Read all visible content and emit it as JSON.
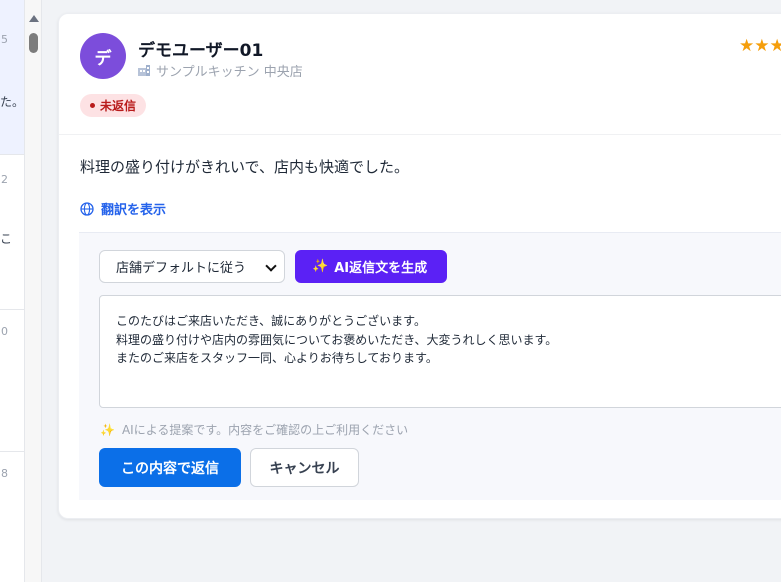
{
  "left_list": {
    "items": [
      {
        "number": "5",
        "fragment": "た。"
      },
      {
        "number": "2",
        "fragment": "こ"
      },
      {
        "number": "0",
        "fragment": ""
      },
      {
        "number": "8",
        "fragment": ""
      }
    ]
  },
  "review": {
    "avatar_initial": "デ",
    "user_name": "デモユーザー01",
    "store_name": "サンプルキッチン 中央店",
    "stars": "★★★",
    "status": "未返信",
    "text": "料理の盛り付けがきれいで、店内も快適でした。",
    "translate_label": "翻訳を表示"
  },
  "reply": {
    "tone_selected": "店舗デフォルトに従う",
    "ai_button_label": "AI返信文を生成",
    "draft": "このたびはご来店いただき、誠にありがとうございます。\n料理の盛り付けや店内の雰囲気についてお褒めいただき、大変うれしく思います。\nまたのご来店をスタッフ一同、心よりお待ちしております。",
    "ai_note": "AIによる提案です。内容をご確認の上ご利用ください",
    "submit_label": "この内容で返信",
    "cancel_label": "キャンセル"
  },
  "colors": {
    "avatar": "#7c4ddb",
    "ai_button": "#5b21f5",
    "submit_button": "#0b6fe8",
    "link": "#2563eb",
    "status_badge_bg": "#fde2e4",
    "status_badge_text": "#b91c1c",
    "stars": "#f59e0b"
  },
  "icons": {
    "store": "building-icon",
    "translate": "globe-icon",
    "ai": "sparkle-icon",
    "select": "chevron-down-icon"
  }
}
